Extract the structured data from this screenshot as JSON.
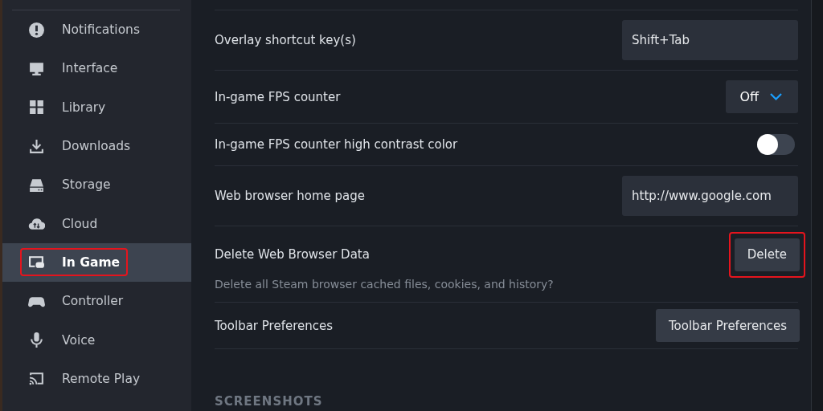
{
  "sidebar": {
    "items": [
      {
        "label": "Notifications",
        "selected": false,
        "highlighted": false
      },
      {
        "label": "Interface",
        "selected": false,
        "highlighted": false
      },
      {
        "label": "Library",
        "selected": false,
        "highlighted": false
      },
      {
        "label": "Downloads",
        "selected": false,
        "highlighted": false
      },
      {
        "label": "Storage",
        "selected": false,
        "highlighted": false
      },
      {
        "label": "Cloud",
        "selected": false,
        "highlighted": false
      },
      {
        "label": "In Game",
        "selected": true,
        "highlighted": true
      },
      {
        "label": "Controller",
        "selected": false,
        "highlighted": false
      },
      {
        "label": "Voice",
        "selected": false,
        "highlighted": false
      },
      {
        "label": "Remote Play",
        "selected": false,
        "highlighted": false
      }
    ]
  },
  "settings": [
    {
      "label": "Overlay shortcut key(s)",
      "kind": "text-input",
      "value": "Shift+Tab"
    },
    {
      "label": "In-game FPS counter",
      "kind": "dropdown",
      "value": "Off"
    },
    {
      "label": "In-game FPS counter high contrast color",
      "kind": "toggle",
      "on": false
    },
    {
      "label": "Web browser home page",
      "kind": "text-input",
      "value": "http://www.google.com"
    },
    {
      "label": "Delete Web Browser Data",
      "kind": "button",
      "button": "Delete",
      "highlighted": true,
      "description": "Delete all Steam browser cached files, cookies, and history?"
    },
    {
      "label": "Toolbar Preferences",
      "kind": "button",
      "button": "Toolbar Preferences",
      "highlighted": false
    }
  ],
  "section_heading": "SCREENSHOTS"
}
